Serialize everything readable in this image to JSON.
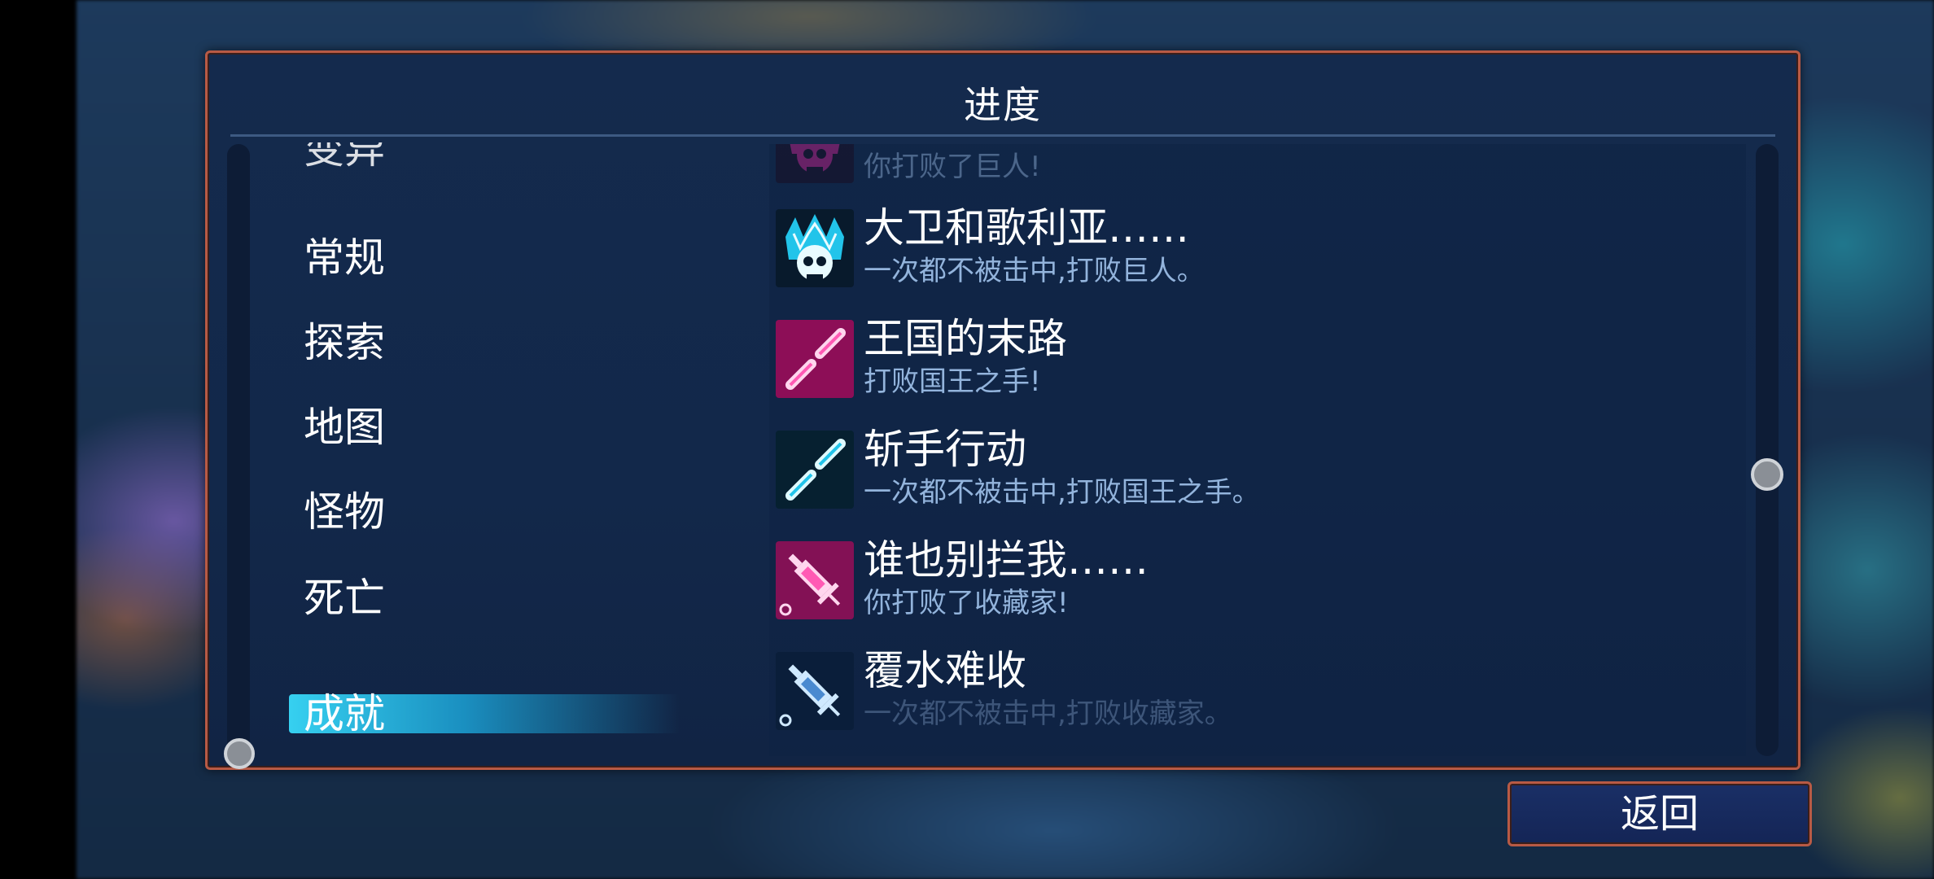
{
  "panel": {
    "title": "进度"
  },
  "categories": [
    {
      "label": "变异",
      "selected": false
    },
    {
      "label": "常规",
      "selected": false
    },
    {
      "label": "探索",
      "selected": false
    },
    {
      "label": "地图",
      "selected": false
    },
    {
      "label": "怪物",
      "selected": false
    },
    {
      "label": "死亡",
      "selected": false
    },
    {
      "label": "成就",
      "selected": true
    }
  ],
  "achievements": [
    {
      "name": "",
      "description": "你打败了巨人!",
      "icon": "skull-crown-icon",
      "color": "#d0208c"
    },
    {
      "name": "大卫和歌利亚……",
      "description": "一次都不被击中,打败巨人。",
      "icon": "skull-crown-icon",
      "color": "#20b8e0"
    },
    {
      "name": "王国的末路",
      "description": "打败国王之手!",
      "icon": "broken-sword-icon",
      "color": "#d0208c"
    },
    {
      "name": "斩手行动",
      "description": "一次都不被击中,打败国王之手。",
      "icon": "broken-sword-icon",
      "color": "#20b8e0"
    },
    {
      "name": "谁也别拦我……",
      "description": "你打败了收藏家!",
      "icon": "syringe-icon",
      "color": "#d0208c"
    },
    {
      "name": "覆水难收",
      "description": "一次都不被击中,打败收藏家。",
      "icon": "syringe-icon",
      "color": "#20b8e0"
    }
  ],
  "footer": {
    "back_label": "返回"
  }
}
